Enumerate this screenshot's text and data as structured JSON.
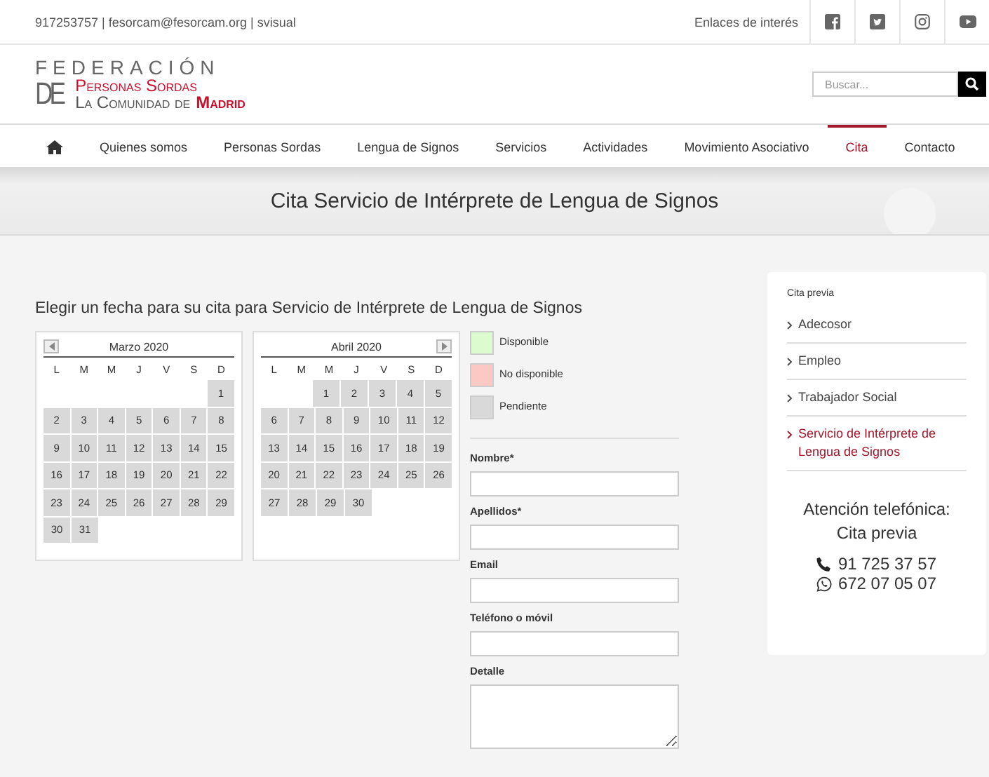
{
  "top_bar": {
    "contact": "917253757 | fesorcam@fesorcam.org | svisual",
    "links_label": "Enlaces de interés",
    "social": [
      {
        "kind": "facebook"
      },
      {
        "kind": "twitter"
      },
      {
        "kind": "instagram"
      },
      {
        "kind": "youtube"
      }
    ]
  },
  "logo": {
    "line1": "FEDERACIÓN",
    "de": "DE",
    "line2": "Personas Sordas",
    "line3": "La Comunidad de",
    "line3_highlight": "Madrid"
  },
  "search": {
    "placeholder": "Buscar..."
  },
  "nav": [
    {
      "kind": "home",
      "selected": false
    },
    {
      "kind": "link",
      "label": "Quienes somos",
      "selected": false
    },
    {
      "kind": "link",
      "label": "Personas Sordas",
      "selected": false
    },
    {
      "kind": "link",
      "label": "Lengua de Signos",
      "selected": false
    },
    {
      "kind": "link",
      "label": "Servicios",
      "selected": false
    },
    {
      "kind": "link",
      "label": "Actividades",
      "selected": false
    },
    {
      "kind": "link",
      "label": "Movimiento Asociativo",
      "selected": false
    },
    {
      "kind": "link",
      "label": "Cita",
      "selected": true
    },
    {
      "kind": "link",
      "label": "Contacto",
      "selected": false
    }
  ],
  "hero": {
    "title": "Cita Servicio de Intérprete de Lengua de Signos"
  },
  "booking": {
    "heading": "Elegir un fecha para su cita para Servicio de Intérprete de Lengua de Signos",
    "calendars": [
      {
        "title": "Marzo 2020",
        "kind": "prev",
        "weekdays": [
          "L",
          "M",
          "M",
          "J",
          "V",
          "S",
          "D"
        ],
        "weeks": [
          [
            {
              "d": "1",
              "kind": "pending"
            }
          ],
          [
            {
              "d": "2",
              "kind": "pending"
            },
            {
              "d": "3",
              "kind": "pending"
            },
            {
              "d": "4",
              "kind": "pending"
            },
            {
              "d": "5",
              "kind": "pending"
            },
            {
              "d": "6",
              "kind": "pending"
            },
            {
              "d": "7",
              "kind": "pending"
            },
            {
              "d": "8",
              "kind": "pending"
            }
          ],
          [
            {
              "d": "9",
              "kind": "pending"
            },
            {
              "d": "10",
              "kind": "pending"
            },
            {
              "d": "11",
              "kind": "pending"
            },
            {
              "d": "12",
              "kind": "pending"
            },
            {
              "d": "13",
              "kind": "pending"
            },
            {
              "d": "14",
              "kind": "pending"
            },
            {
              "d": "15",
              "kind": "pending"
            }
          ],
          [
            {
              "d": "16",
              "kind": "pending"
            },
            {
              "d": "17",
              "kind": "pending"
            },
            {
              "d": "18",
              "kind": "pending"
            },
            {
              "d": "19",
              "kind": "pending"
            },
            {
              "d": "20",
              "kind": "pending"
            },
            {
              "d": "21",
              "kind": "pending"
            },
            {
              "d": "22",
              "kind": "pending"
            }
          ],
          [
            {
              "d": "23",
              "kind": "pending"
            },
            {
              "d": "24",
              "kind": "pending"
            },
            {
              "d": "25",
              "kind": "pending"
            },
            {
              "d": "26",
              "kind": "pending"
            },
            {
              "d": "27",
              "kind": "pending"
            },
            {
              "d": "28",
              "kind": "pending"
            },
            {
              "d": "29",
              "kind": "pending"
            }
          ],
          [
            {
              "d": "30",
              "kind": "pending"
            },
            {
              "d": "31",
              "kind": "pending"
            }
          ]
        ]
      },
      {
        "title": "Abril 2020",
        "kind": "next",
        "weekdays": [
          "L",
          "M",
          "M",
          "J",
          "V",
          "S",
          "D"
        ],
        "weeks": [
          [
            {
              "d": "1",
              "kind": "pending"
            },
            {
              "d": "2",
              "kind": "pending"
            },
            {
              "d": "3",
              "kind": "pending"
            },
            {
              "d": "4",
              "kind": "pending"
            },
            {
              "d": "5",
              "kind": "pending"
            }
          ],
          [
            {
              "d": "6",
              "kind": "pending"
            },
            {
              "d": "7",
              "kind": "pending"
            },
            {
              "d": "8",
              "kind": "pending"
            },
            {
              "d": "9",
              "kind": "pending"
            },
            {
              "d": "10",
              "kind": "pending"
            },
            {
              "d": "11",
              "kind": "pending"
            },
            {
              "d": "12",
              "kind": "pending"
            }
          ],
          [
            {
              "d": "13",
              "kind": "pending"
            },
            {
              "d": "14",
              "kind": "pending"
            },
            {
              "d": "15",
              "kind": "pending"
            },
            {
              "d": "16",
              "kind": "pending"
            },
            {
              "d": "17",
              "kind": "pending"
            },
            {
              "d": "18",
              "kind": "pending"
            },
            {
              "d": "19",
              "kind": "pending"
            }
          ],
          [
            {
              "d": "20",
              "kind": "pending"
            },
            {
              "d": "21",
              "kind": "pending"
            },
            {
              "d": "22",
              "kind": "pending"
            },
            {
              "d": "23",
              "kind": "pending"
            },
            {
              "d": "24",
              "kind": "pending"
            },
            {
              "d": "25",
              "kind": "pending"
            },
            {
              "d": "26",
              "kind": "pending"
            }
          ],
          [
            {
              "d": "27",
              "kind": "pending"
            },
            {
              "d": "28",
              "kind": "pending"
            },
            {
              "d": "29",
              "kind": "pending"
            },
            {
              "d": "30",
              "kind": "pending"
            }
          ]
        ]
      }
    ],
    "legend": [
      {
        "kind": "available",
        "label": "Disponible",
        "color": "#dcfcd0"
      },
      {
        "kind": "unavailable",
        "label": "No disponible",
        "color": "#fcc8c4"
      },
      {
        "kind": "pending",
        "label": "Pendiente",
        "color": "#d9d9d9"
      }
    ],
    "fields": [
      {
        "kind": "input",
        "label": "Nombre*"
      },
      {
        "kind": "input",
        "label": "Apellidos*"
      },
      {
        "kind": "input",
        "label": "Email"
      },
      {
        "kind": "input",
        "label": "Teléfono o móvil"
      },
      {
        "kind": "textarea",
        "label": "Detalle"
      }
    ]
  },
  "sidebar": {
    "title": "Cita previa",
    "items": [
      {
        "label": "Adecosor",
        "selected": false
      },
      {
        "label": "Empleo",
        "selected": false
      },
      {
        "label": "Trabajador Social",
        "selected": false
      },
      {
        "label": "Servicio de Intérprete de Lengua de Signos",
        "selected": true
      }
    ],
    "contact_title": "Atención telefónica:",
    "contact_subtitle": "Cita previa",
    "numbers": [
      {
        "kind": "phone",
        "number": "91 725 37 57"
      },
      {
        "kind": "whatsapp",
        "number": "672 07 05 07"
      }
    ]
  }
}
